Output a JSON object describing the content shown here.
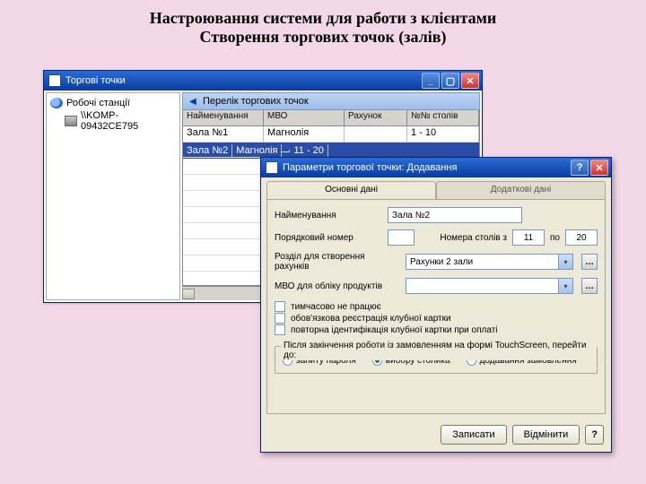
{
  "heading": {
    "line1": "Настроювання системи  для работи з клієнтами",
    "line2": "Створення торгових точок (залів)"
  },
  "main": {
    "title": "Торгові точки",
    "tree": {
      "root": "Робочі станції",
      "child": "\\\\KOMP-09432CE795"
    },
    "right_title": "Перелік торгових точок",
    "columns": [
      "Найменування",
      "МВО",
      "Рахунок",
      "№№ столів"
    ],
    "rows": [
      {
        "name": "Зала №1",
        "mvo": "Магнолія",
        "acct": "",
        "tables": "1 - 10",
        "selected": false
      },
      {
        "name": "Зала №2",
        "mvo": "Магнолія",
        "acct": "",
        "tables": "11 - 20",
        "selected": true
      }
    ]
  },
  "dialog": {
    "title": "Параметри торгової точки: Додавання",
    "tabs": {
      "main": "Основні дані",
      "extra": "Додаткові дані"
    },
    "labels": {
      "name": "Найменування",
      "order": "Порядковий номер",
      "tables": "Номера столів   з",
      "to": "по",
      "section": "Розділ для створення рахунків",
      "mvo": "МВО для обліку продуктів",
      "cb1": "тимчасово не працює",
      "cb2": "обов'язкова реєстрація клубної картки",
      "cb3": "повторна ідентифікація клубної картки при оплаті",
      "group": "Після закінчення роботи із замовленням на формі TouchScreen, перейти до:",
      "r1": "запиту пароля",
      "r2": "вибору столика",
      "r3": "додавання замовлення",
      "save": "Записати",
      "cancel": "Відмінити",
      "help": "?"
    },
    "values": {
      "name": "Зала №2",
      "order": "",
      "t_from": "11",
      "t_to": "20",
      "section": "Рахунки 2 зали",
      "mvo": ""
    }
  }
}
